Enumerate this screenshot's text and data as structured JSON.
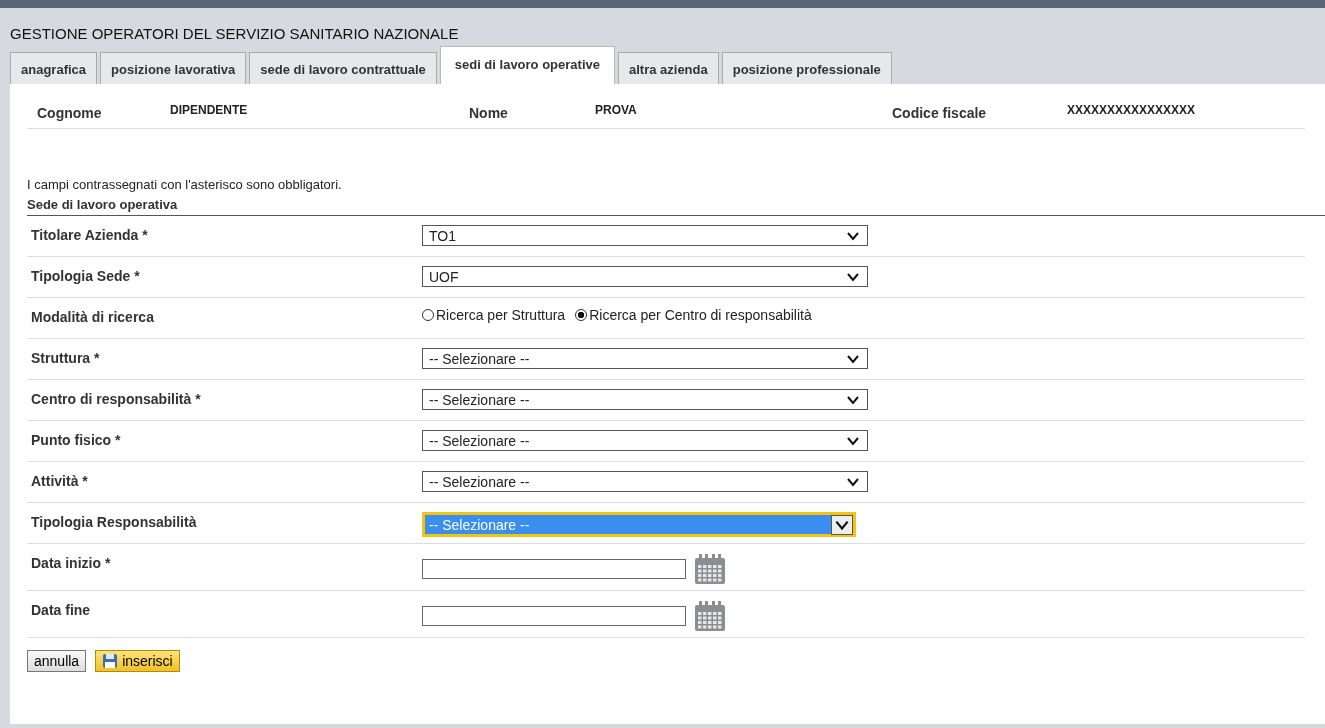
{
  "header": {
    "title": "GESTIONE OPERATORI DEL SERVIZIO SANITARIO NAZIONALE"
  },
  "tabs": [
    {
      "label": "anagrafica",
      "selected": false
    },
    {
      "label": "posizione lavorativa",
      "selected": false
    },
    {
      "label": "sede di lavoro contrattuale",
      "selected": false
    },
    {
      "label": "sedi di lavoro operative",
      "selected": true
    },
    {
      "label": "altra azienda",
      "selected": false
    },
    {
      "label": "posizione professionale",
      "selected": false
    }
  ],
  "person": [
    {
      "label": "Cognome",
      "value": "DIPENDENTE"
    },
    {
      "label": "Nome",
      "value": "PROVA"
    },
    {
      "label": "Codice fiscale",
      "value": "XXXXXXXXXXXXXXXX"
    }
  ],
  "note": "I campi contrassegnati con l'asterisco sono obbligatori.",
  "section_title": "Sede di lavoro operativa",
  "fields": [
    {
      "kind": "select",
      "label": "Titolare Azienda *",
      "value": "TO1",
      "focused": false
    },
    {
      "kind": "select",
      "label": "Tipologia Sede *",
      "value": "UOF",
      "focused": false
    },
    {
      "kind": "radio",
      "label": "Modalità di ricerca",
      "options": [
        {
          "label": "Ricerca per Struttura",
          "selected": false
        },
        {
          "label": "Ricerca per Centro di responsabilità",
          "selected": true
        }
      ]
    },
    {
      "kind": "select",
      "label": "Struttura  *",
      "value": "-- Selezionare --",
      "focused": false
    },
    {
      "kind": "select",
      "label": "Centro di responsabilità *",
      "value": "-- Selezionare --",
      "focused": false
    },
    {
      "kind": "select",
      "label": "Punto fisico *",
      "value": "-- Selezionare --",
      "focused": false
    },
    {
      "kind": "select",
      "label": "Attività  *",
      "value": "-- Selezionare --",
      "focused": false
    },
    {
      "kind": "select",
      "label": "Tipologia Responsabilità",
      "value": "-- Selezionare --",
      "focused": true
    },
    {
      "kind": "date",
      "label": "Data inizio *"
    },
    {
      "kind": "date",
      "label": "Data fine"
    }
  ],
  "buttons": [
    {
      "label": "annulla",
      "primary": false
    },
    {
      "label": "inserisci",
      "primary": true
    }
  ]
}
